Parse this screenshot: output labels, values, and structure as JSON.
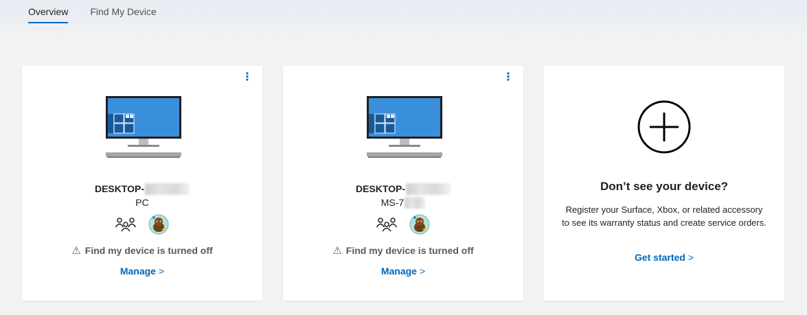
{
  "tabs": [
    {
      "label": "Overview",
      "active": true
    },
    {
      "label": "Find My Device",
      "active": false
    }
  ],
  "devices": [
    {
      "name_prefix": "DESKTOP-",
      "type": "PC",
      "more_label": "⋮",
      "status": "Find my device is turned off",
      "manage": "Manage",
      "chevron": ">"
    },
    {
      "name_prefix": "DESKTOP-",
      "type": "MS-7",
      "more_label": "⋮",
      "status": "Find my device is turned off",
      "manage": "Manage",
      "chevron": ">"
    }
  ],
  "add_card": {
    "title": "Don’t see your device?",
    "text": "Register your Surface, Xbox, or related accessory to see its warranty status and create service orders.",
    "link": "Get started",
    "chevron": ">"
  },
  "colors": {
    "accent": "#0067b8",
    "monitor_blue": "#3a8fdc",
    "warning_gray": "#595959"
  },
  "icons": [
    "more-icon",
    "monitor-icon",
    "family-icon",
    "avatar",
    "warning-icon",
    "plus-circle-icon",
    "chevron-right-icon"
  ]
}
